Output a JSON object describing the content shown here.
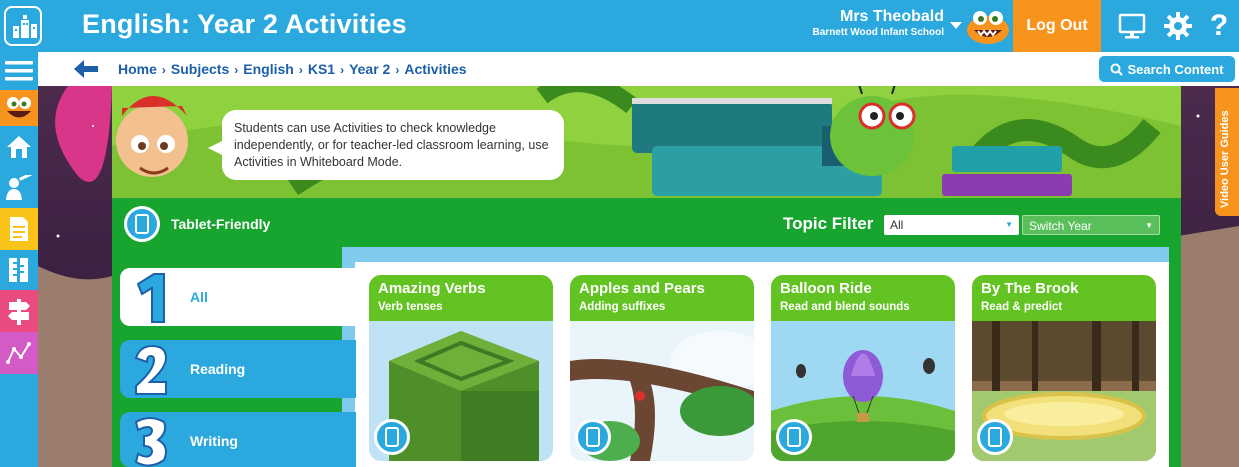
{
  "header": {
    "title": "English: Year 2 Activities",
    "user_name": "Mrs Theobald",
    "school": "Barnett Wood Infant School",
    "logout_label": "Log Out",
    "icons": [
      "logo-icon",
      "monitor-icon",
      "gear-icon",
      "help-icon"
    ],
    "help_glyph": "?"
  },
  "sidebar": {
    "items": [
      {
        "icon": "menu-icon",
        "color": "#2ba9de"
      },
      {
        "icon": "monster-icon",
        "color": "#f7941d"
      },
      {
        "icon": "home-icon",
        "color": "#2ba9de"
      },
      {
        "icon": "teacher-icon",
        "color": "#2ba9de"
      },
      {
        "icon": "document-icon",
        "color": "#f9c319"
      },
      {
        "icon": "ruler-icon",
        "color": "#2ba9de"
      },
      {
        "icon": "signpost-icon",
        "color": "#e94b7e"
      },
      {
        "icon": "graph-icon",
        "color": "#d45bc5"
      }
    ]
  },
  "breadcrumb": {
    "items": [
      "Home",
      "Subjects",
      "English",
      "KS1",
      "Year 2",
      "Activities"
    ],
    "separator": "›",
    "search_label": "Search Content"
  },
  "banner": {
    "speech": "Students can use Activities to check knowledge independently, or for teacher-led classroom learning, use Activities in Whiteboard Mode.",
    "video_tab": "Video User Guides"
  },
  "filters": {
    "tablet_label": "Tablet-Friendly",
    "topic_label": "Topic Filter",
    "topic_value": "All",
    "year_placeholder": "Switch Year"
  },
  "categories": [
    {
      "number": "1",
      "label": "All",
      "active": true
    },
    {
      "number": "2",
      "label": "Reading",
      "active": false
    },
    {
      "number": "3",
      "label": "Writing",
      "active": false
    }
  ],
  "cards": [
    {
      "title": "Amazing Verbs",
      "subtitle": "Verb tenses"
    },
    {
      "title": "Apples and Pears",
      "subtitle": "Adding suffixes"
    },
    {
      "title": "Balloon Ride",
      "subtitle": "Read and blend sounds"
    },
    {
      "title": "By The Brook",
      "subtitle": "Read & predict"
    }
  ],
  "colors": {
    "brand_blue": "#2ba9de",
    "orange": "#f7941d",
    "green": "#17a42f",
    "card_green": "#63c322",
    "crumb_blue": "#1d5fa8"
  }
}
